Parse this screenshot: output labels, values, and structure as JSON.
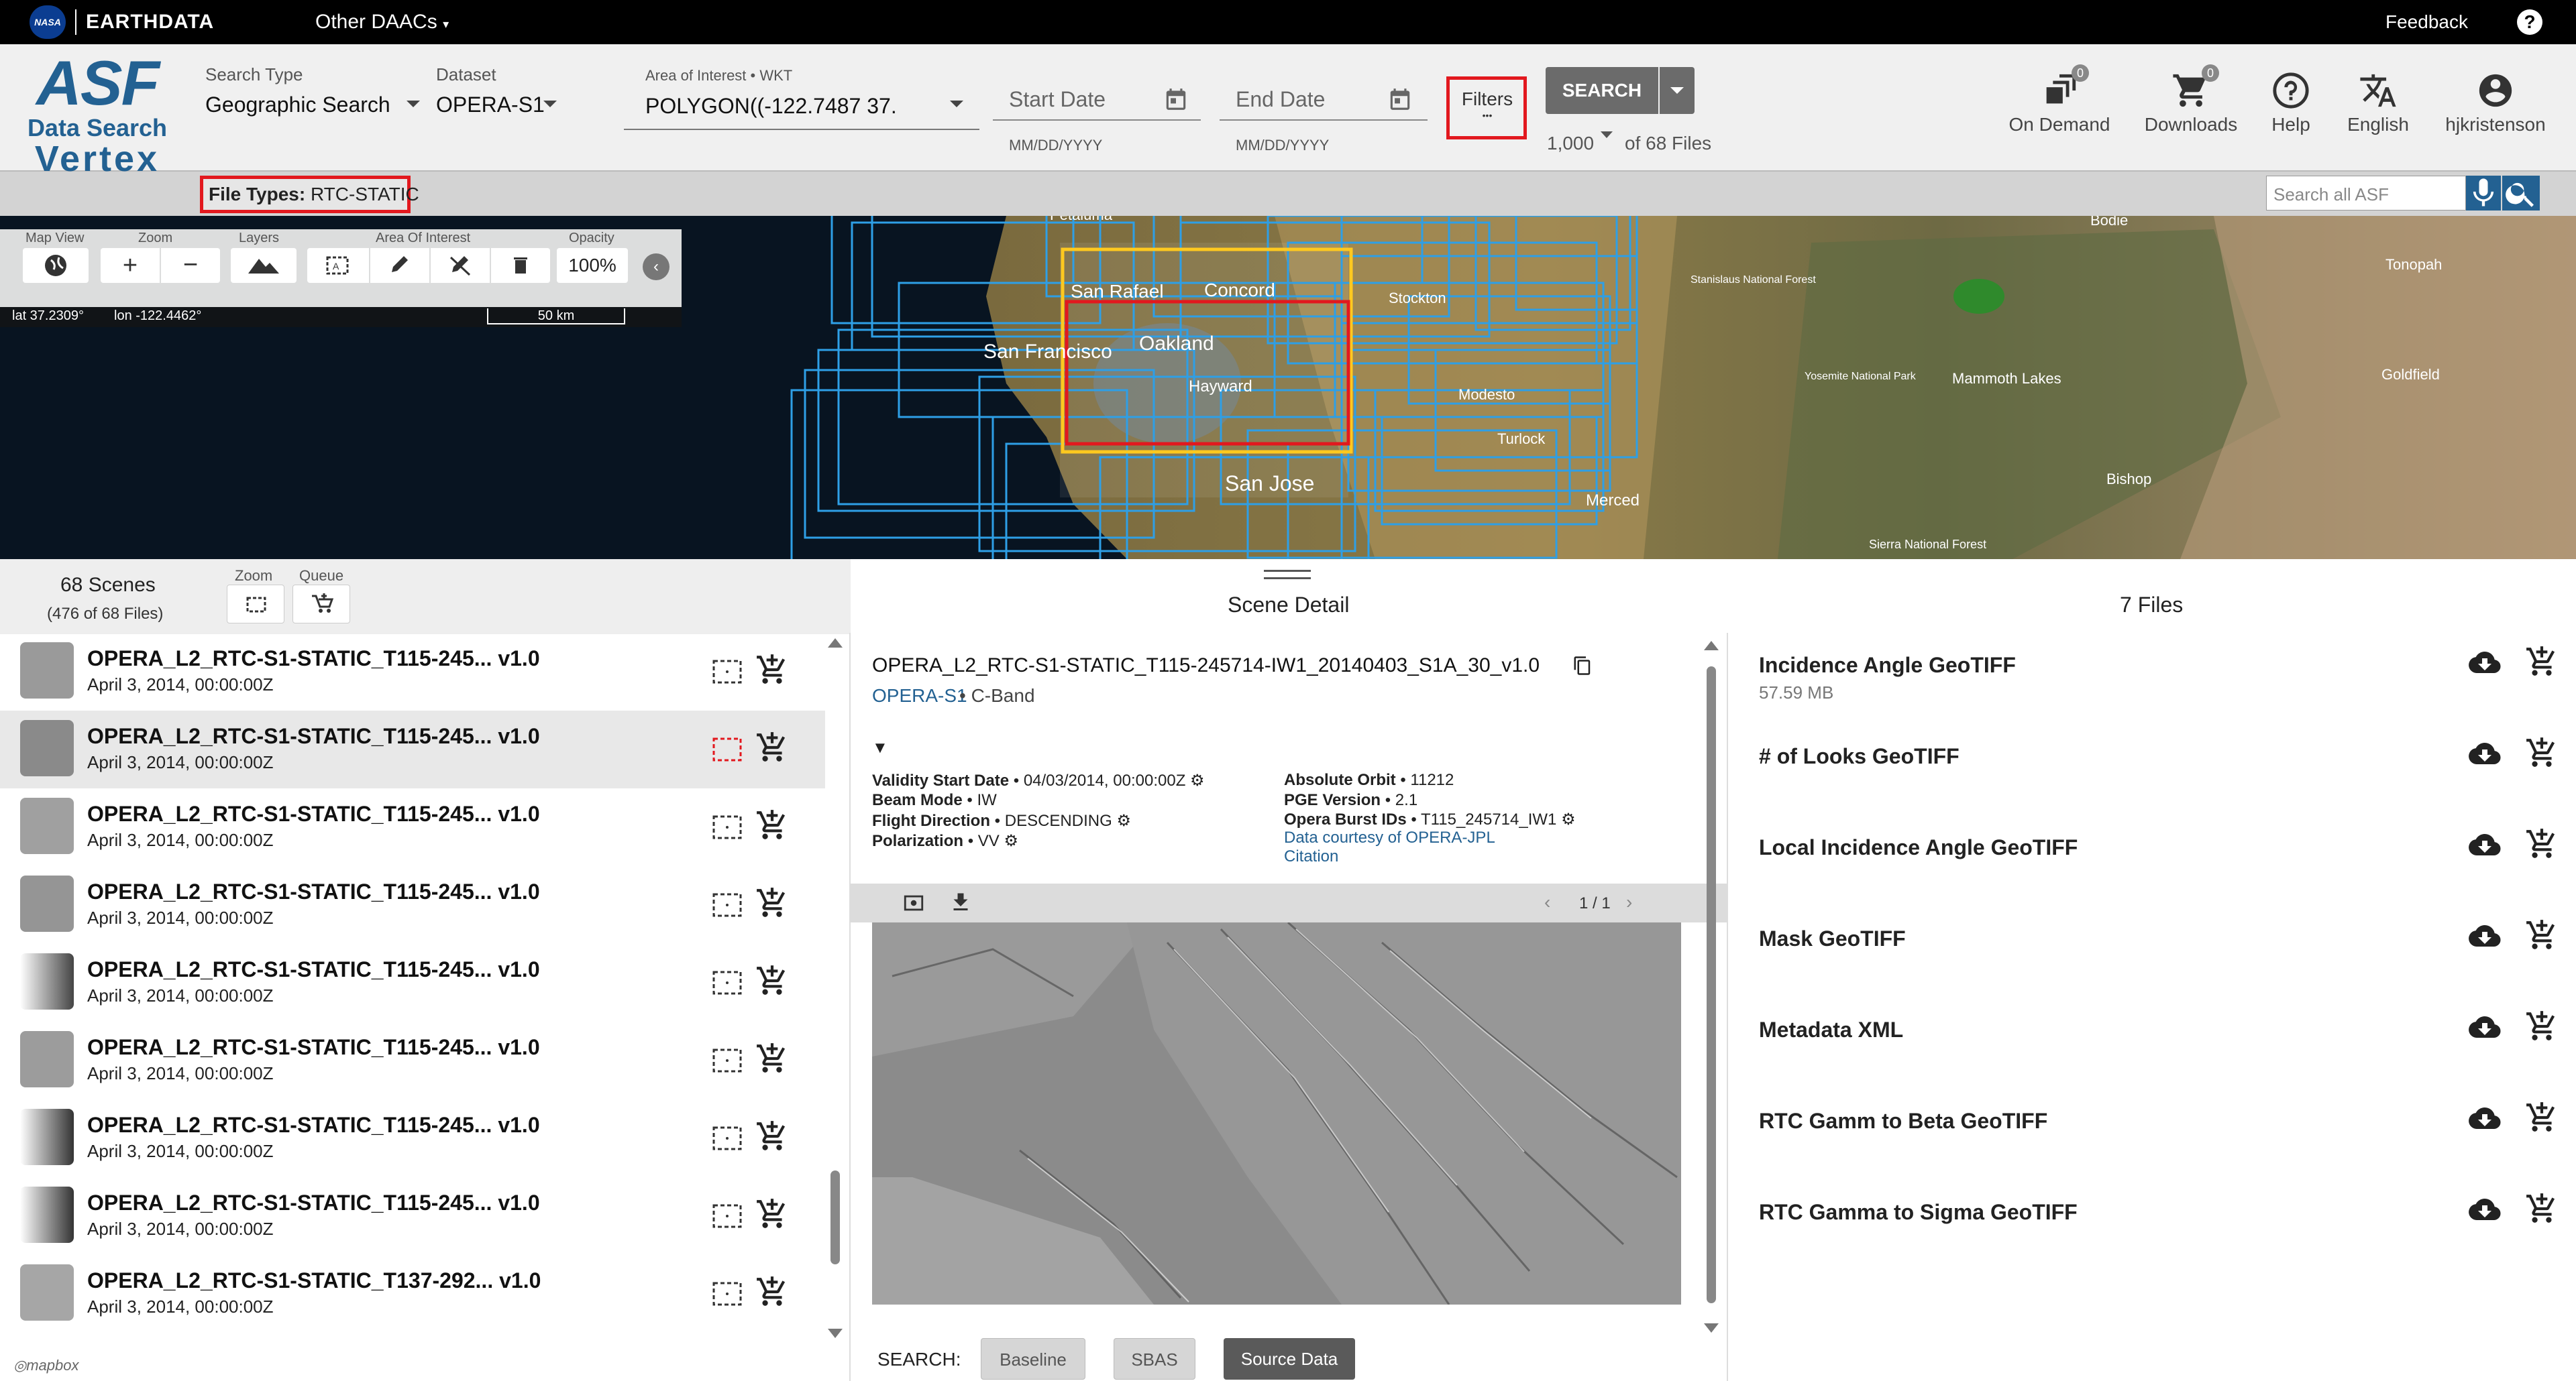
{
  "topnav": {
    "earthdata": "EARTHDATA",
    "other_daacs": "Other DAACs",
    "feedback": "Feedback",
    "help_glyph": "?"
  },
  "logo": {
    "asf": "ASF",
    "data_search": "Data Search",
    "vertex": "Vertex"
  },
  "search": {
    "type_label": "Search Type",
    "type_value": "Geographic Search",
    "dataset_label": "Dataset",
    "dataset_value": "OPERA-S1",
    "aoi_label": "Area of Interest • WKT",
    "aoi_value": "POLYGON((-122.7487 37.",
    "start_date": "Start Date",
    "end_date": "End Date",
    "date_format": "MM/DD/YYYY",
    "filters_label": "Filters",
    "filters_dots": "•••",
    "search_button": "SEARCH",
    "max_results": "1,000",
    "of_files": "of 68 Files"
  },
  "nav": {
    "on_demand": "On Demand",
    "on_demand_count": "0",
    "downloads": "Downloads",
    "downloads_count": "0",
    "help": "Help",
    "language": "English",
    "user": "hjkristenson"
  },
  "filter_bar": {
    "file_types_label": "File Types:",
    "file_types_value": "RTC-STATIC",
    "search_asf_placeholder": "Search all ASF"
  },
  "map_toolbar": {
    "map_view": "Map View",
    "zoom": "Zoom",
    "layers": "Layers",
    "aoi": "Area Of Interest",
    "opacity": "Opacity",
    "opacity_value": "100%",
    "lat": "lat 37.2309°",
    "lon": "lon -122.4462°",
    "scale": "50 km"
  },
  "map_labels": {
    "san_rafael": "San Rafael",
    "concord": "Concord",
    "san_francisco": "San Francisco",
    "oakland": "Oakland",
    "hayward": "Hayward",
    "san_jose": "San Jose",
    "stockton": "Stockton",
    "modesto": "Modesto",
    "turlock": "Turlock",
    "merced": "Merced",
    "bodie": "Bodie",
    "stanislaus": "Stanislaus National Forest",
    "yosemite": "Yosemite National Park",
    "mammoth": "Mammoth Lakes",
    "tonopah": "Tonopah",
    "goldfield": "Goldfield",
    "bishop": "Bishop",
    "sierra": "Sierra National Forest",
    "petaluma": "Petaluma",
    "mapbox": "mapbox"
  },
  "results": {
    "scenes_count": "68 Scenes",
    "files_count": "(476 of 68 Files)",
    "zoom_label": "Zoom",
    "queue_label": "Queue",
    "scene_detail": "Scene Detail",
    "files_header": "7 Files",
    "scenes": [
      {
        "title": "OPERA_L2_RTC-S1-STATIC_T115-245... v1.0",
        "date": "April 3, 2014, 00:00:00Z"
      },
      {
        "title": "OPERA_L2_RTC-S1-STATIC_T115-245... v1.0",
        "date": "April 3, 2014, 00:00:00Z"
      },
      {
        "title": "OPERA_L2_RTC-S1-STATIC_T115-245... v1.0",
        "date": "April 3, 2014, 00:00:00Z"
      },
      {
        "title": "OPERA_L2_RTC-S1-STATIC_T115-245... v1.0",
        "date": "April 3, 2014, 00:00:00Z"
      },
      {
        "title": "OPERA_L2_RTC-S1-STATIC_T115-245... v1.0",
        "date": "April 3, 2014, 00:00:00Z"
      },
      {
        "title": "OPERA_L2_RTC-S1-STATIC_T115-245... v1.0",
        "date": "April 3, 2014, 00:00:00Z"
      },
      {
        "title": "OPERA_L2_RTC-S1-STATIC_T115-245... v1.0",
        "date": "April 3, 2014, 00:00:00Z"
      },
      {
        "title": "OPERA_L2_RTC-S1-STATIC_T115-245... v1.0",
        "date": "April 3, 2014, 00:00:00Z"
      },
      {
        "title": "OPERA_L2_RTC-S1-STATIC_T137-292... v1.0",
        "date": "April 3, 2014, 00:00:00Z"
      }
    ]
  },
  "detail": {
    "scene_name": "OPERA_L2_RTC-S1-STATIC_T115-245714-IW1_20140403_S1A_30_v1.0",
    "dataset_link": "OPERA-S1",
    "band": "• C-Band",
    "collapse": "▼",
    "validity_label": "Validity Start Date",
    "validity_value": " • 04/03/2014, 00:00:00Z",
    "beam_label": "Beam Mode",
    "beam_value": " • IW",
    "flight_label": "Flight Direction",
    "flight_value": " • DESCENDING",
    "pol_label": "Polarization",
    "pol_value": " • VV",
    "orbit_label": "Absolute Orbit",
    "orbit_value": " • 11212",
    "pge_label": "PGE Version",
    "pge_value": " • 2.1",
    "burst_label": "Opera Burst IDs",
    "burst_value": " • T115_245714_IW1",
    "courtesy": "Data courtesy of OPERA-JPL",
    "citation": "Citation",
    "pager": "1 / 1",
    "search_label": "SEARCH:",
    "baseline": "Baseline",
    "sbas": "SBAS",
    "source_data": "Source Data"
  },
  "files": [
    {
      "name": "Incidence Angle GeoTIFF",
      "size": "57.59 MB"
    },
    {
      "name": "# of Looks GeoTIFF",
      "size": ""
    },
    {
      "name": "Local Incidence Angle GeoTIFF",
      "size": ""
    },
    {
      "name": "Mask GeoTIFF",
      "size": ""
    },
    {
      "name": "Metadata XML",
      "size": ""
    },
    {
      "name": "RTC Gamm to Beta GeoTIFF",
      "size": ""
    },
    {
      "name": "RTC Gamma to Sigma GeoTIFF",
      "size": ""
    }
  ],
  "colors": {
    "accent": "#236192",
    "highlight": "#e2181e",
    "aoi": "#ffc91f",
    "footprint": "#2e9fe6"
  }
}
